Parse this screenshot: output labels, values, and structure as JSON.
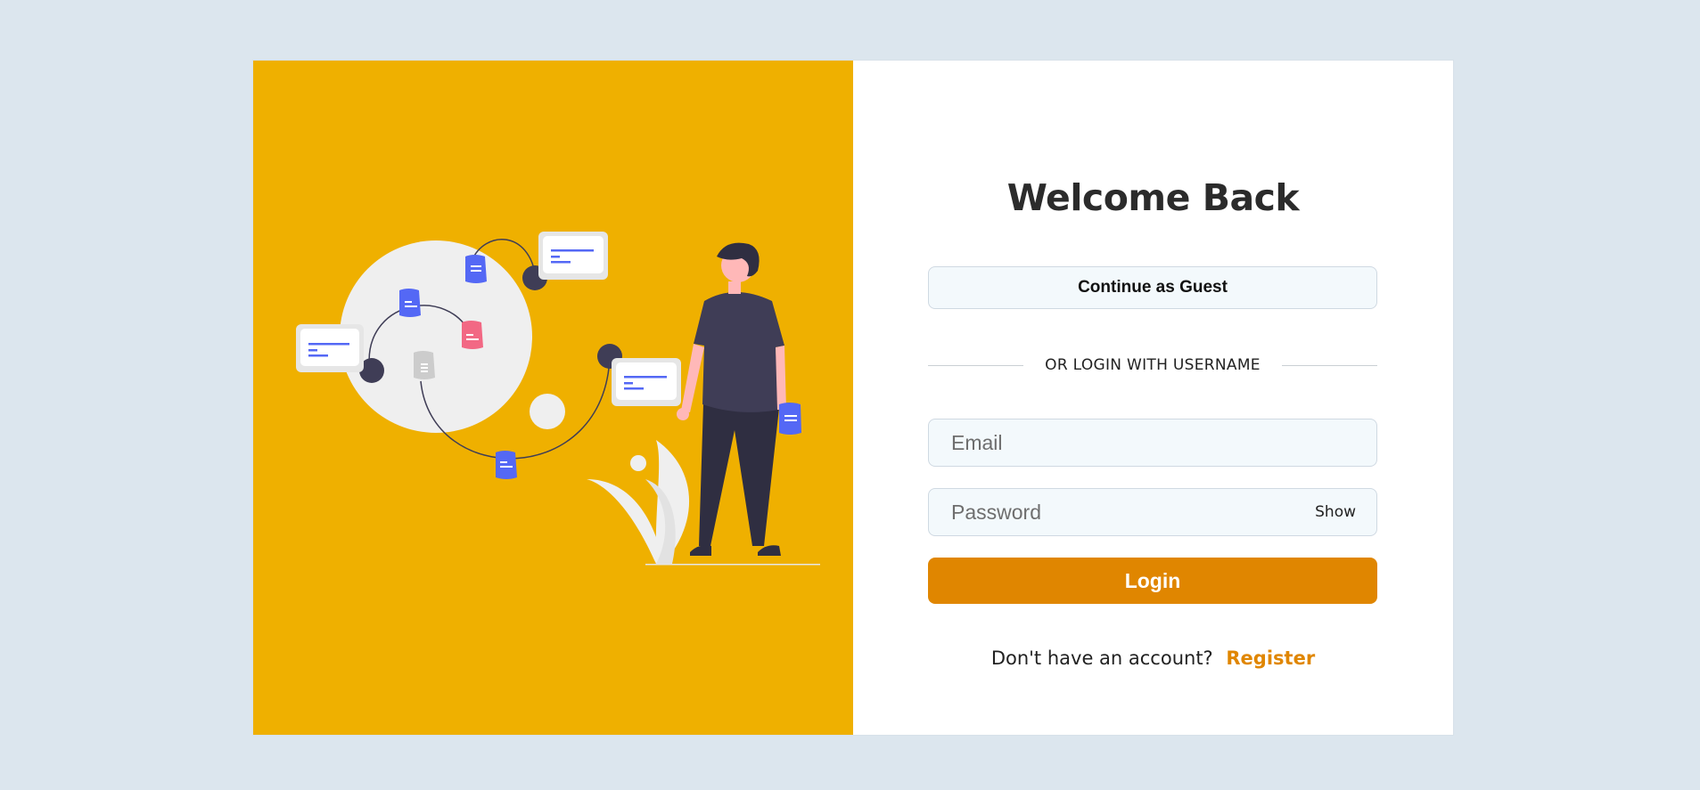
{
  "login": {
    "title": "Welcome Back",
    "guest_button_label": "Continue as Guest",
    "divider_text": "OR LOGIN WITH USERNAME",
    "email_placeholder": "Email",
    "email_value": "",
    "password_placeholder": "Password",
    "password_value": "",
    "show_toggle_label": "Show",
    "login_button_label": "Login",
    "register_prompt": "Don't have an account?",
    "register_link_label": "Register"
  },
  "theme": {
    "page_background": "#dce6ee",
    "illustration_background": "#efb000",
    "accent": "#e08600",
    "field_background": "#f3f9fc",
    "document_blue": "#5468f5",
    "document_pink": "#f26884",
    "dark": "#3f3d56"
  },
  "illustration": {
    "icon": "person-with-documents-illustration"
  }
}
